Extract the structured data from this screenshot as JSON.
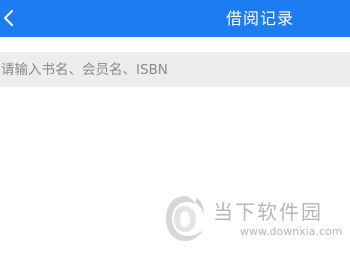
{
  "header": {
    "title": "借阅记录",
    "back_icon": "chevron-left-icon",
    "background_color": "#1e7cf3"
  },
  "search": {
    "placeholder": "请输入书名、会员名、ISBN",
    "value": ""
  },
  "watermark": {
    "name": "当下软件园",
    "url": "www.downxia.com"
  }
}
